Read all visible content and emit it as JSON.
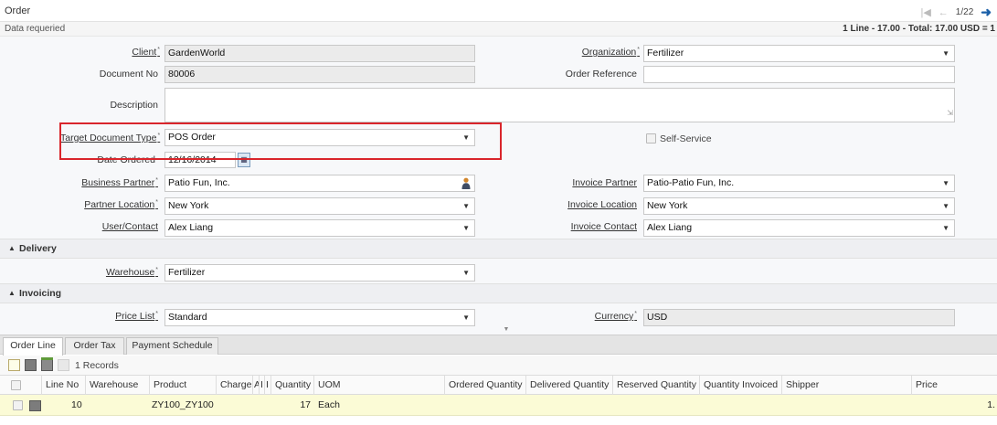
{
  "window": {
    "title": "Order",
    "pager": "1/22",
    "first_icon": "first-record-icon",
    "prev_icon": "previous-record-icon",
    "next_icon": "next-record-icon"
  },
  "status": {
    "message": "Data requeried",
    "summary": "1 Line - 17.00 - Total: 17.00 USD = 1"
  },
  "header": {
    "client_label": "Client",
    "client_value": "GardenWorld",
    "organization_label": "Organization",
    "organization_value": "Fertilizer",
    "document_no_label": "Document No",
    "document_no_value": "80006",
    "order_reference_label": "Order Reference",
    "order_reference_value": "",
    "description_label": "Description",
    "description_value": "",
    "target_doc_type_label": "Target Document Type",
    "target_doc_type_value": "POS Order",
    "self_service_label": "Self-Service",
    "date_ordered_label": "Date Ordered",
    "date_ordered_value": "12/16/2014",
    "business_partner_label": "Business Partner",
    "business_partner_value": "Patio Fun, Inc.",
    "invoice_partner_label": "Invoice Partner",
    "invoice_partner_value": "Patio-Patio Fun, Inc.",
    "partner_location_label": "Partner Location",
    "partner_location_value": "New York",
    "invoice_location_label": "Invoice Location",
    "invoice_location_value": "New York",
    "user_contact_label": "User/Contact",
    "user_contact_value": "Alex Liang",
    "invoice_contact_label": "Invoice Contact",
    "invoice_contact_value": "Alex Liang",
    "required_mark": "*"
  },
  "delivery": {
    "section_title": "Delivery",
    "warehouse_label": "Warehouse",
    "warehouse_value": "Fertilizer"
  },
  "invoicing": {
    "section_title": "Invoicing",
    "price_list_label": "Price List",
    "price_list_value": "Standard",
    "currency_label": "Currency",
    "currency_value": "USD"
  },
  "tabs": [
    {
      "label": "Order Line"
    },
    {
      "label": "Order Tax"
    },
    {
      "label": "Payment Schedule"
    }
  ],
  "grid": {
    "records_label": "1 Records",
    "columns": [
      "Line No",
      "Warehouse",
      "Product",
      "Charge",
      "A",
      "I",
      "I",
      "Quantity",
      "UOM",
      "Ordered Quantity",
      "Delivered Quantity",
      "Reserved Quantity",
      "Quantity Invoiced",
      "Shipper",
      "Price"
    ],
    "rows": [
      {
        "line_no": "10",
        "warehouse": "",
        "product": "ZY100_ZY100",
        "charge": "",
        "quantity": "17",
        "uom": "Each",
        "ordered": "",
        "delivered": "",
        "reserved": "",
        "invoiced": "",
        "shipper": "",
        "price": "1."
      }
    ]
  },
  "colors": {
    "highlight_border": "#d9252b",
    "selected_row": "#fbfbd6",
    "next_arrow": "#1a5fa8"
  }
}
